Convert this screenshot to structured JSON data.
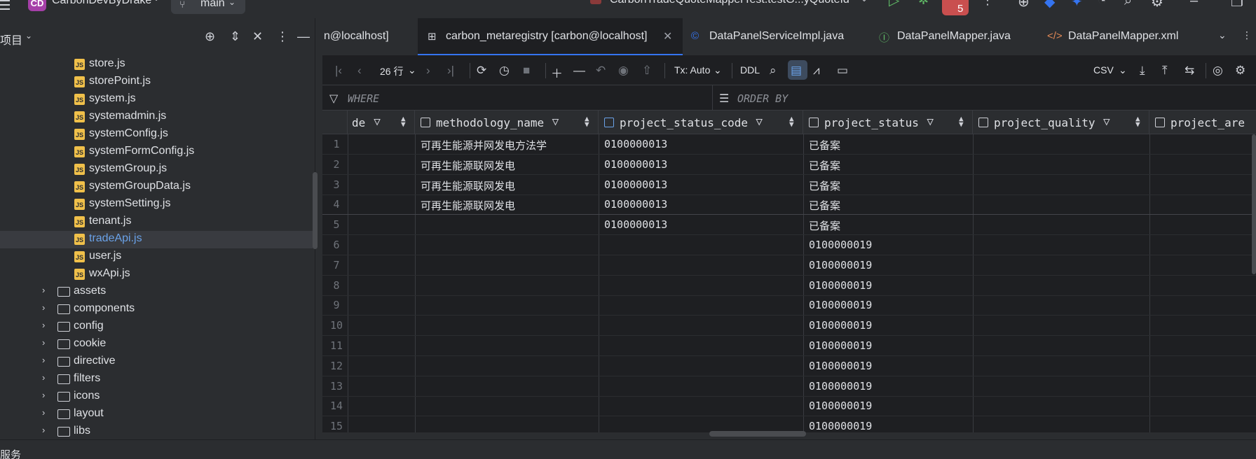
{
  "titlebar": {
    "project_badge": "CD",
    "project_name": "CarbonDevByDrake",
    "branch": "main",
    "run_config": "CarbonTradeQuoteMapperTest.testG...yQuoteId",
    "problems_count": "5"
  },
  "project_pane": {
    "title": "项目",
    "files": [
      "store.js",
      "storePoint.js",
      "system.js",
      "systemadmin.js",
      "systemConfig.js",
      "systemFormConfig.js",
      "systemGroup.js",
      "systemGroupData.js",
      "systemSetting.js",
      "tenant.js",
      "tradeApi.js",
      "user.js",
      "wxApi.js"
    ],
    "selected_file": "tradeApi.js",
    "folders": [
      "assets",
      "components",
      "config",
      "cookie",
      "directive",
      "filters",
      "icons",
      "layout",
      "libs"
    ]
  },
  "tabs": [
    {
      "label": "n@localhost]",
      "icon": "none"
    },
    {
      "label": "carbon_metaregistry [carbon@localhost]",
      "icon": "table-icon",
      "active": true
    },
    {
      "label": "DataPanelServiceImpl.java",
      "icon": "class-icon"
    },
    {
      "label": "DataPanelMapper.java",
      "icon": "interface-icon"
    },
    {
      "label": "DataPanelMapper.xml",
      "icon": "xml-icon"
    }
  ],
  "grid_toolbar": {
    "rows_label": "26 行",
    "tx_label": "Tx: Auto",
    "ddl_label": "DDL",
    "export_format": "CSV"
  },
  "filter_bar": {
    "where_label": "WHERE",
    "order_by_label": "ORDER BY"
  },
  "grid": {
    "columns": [
      "de",
      "methodology_name",
      "project_status_code",
      "project_status",
      "project_quality",
      "project_are"
    ],
    "rows": [
      {
        "n": "1",
        "methodology_name": "可再生能源并网发电方法学",
        "project_status_code": "0100000013",
        "project_status": "已备案"
      },
      {
        "n": "2",
        "methodology_name": "可再生能源联网发电",
        "project_status_code": "0100000013",
        "project_status": "已备案"
      },
      {
        "n": "3",
        "methodology_name": "可再生能源联网发电",
        "project_status_code": "0100000013",
        "project_status": "已备案"
      },
      {
        "n": "4",
        "methodology_name": "可再生能源联网发电",
        "project_status_code": "0100000013",
        "project_status": "已备案"
      },
      {
        "n": "5",
        "methodology_name": "",
        "project_status_code": "0100000013",
        "project_status": "已备案"
      },
      {
        "n": "6",
        "methodology_name": "",
        "project_status_code": "",
        "project_status": "0100000019"
      },
      {
        "n": "7",
        "methodology_name": "",
        "project_status_code": "",
        "project_status": "0100000019"
      },
      {
        "n": "8",
        "methodology_name": "",
        "project_status_code": "",
        "project_status": "0100000019"
      },
      {
        "n": "9",
        "methodology_name": "",
        "project_status_code": "",
        "project_status": "0100000019"
      },
      {
        "n": "10",
        "methodology_name": "",
        "project_status_code": "",
        "project_status": "0100000019"
      },
      {
        "n": "11",
        "methodology_name": "",
        "project_status_code": "",
        "project_status": "0100000019"
      },
      {
        "n": "12",
        "methodology_name": "",
        "project_status_code": "",
        "project_status": "0100000019"
      },
      {
        "n": "13",
        "methodology_name": "",
        "project_status_code": "",
        "project_status": "0100000019"
      },
      {
        "n": "14",
        "methodology_name": "",
        "project_status_code": "",
        "project_status": "0100000019"
      },
      {
        "n": "15",
        "methodology_name": "",
        "project_status_code": "",
        "project_status": "0100000019"
      }
    ]
  },
  "statusbar": {
    "text": "服务"
  }
}
